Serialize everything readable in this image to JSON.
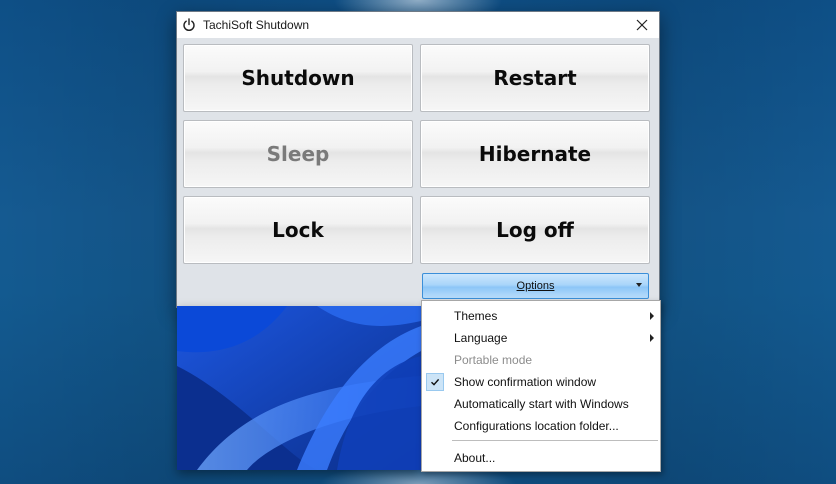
{
  "window": {
    "title": "TachiSoft Shutdown",
    "icon": "power-icon",
    "close_icon": "close-icon"
  },
  "buttons": {
    "shutdown": "Shutdown",
    "restart": "Restart",
    "sleep": "Sleep",
    "hibernate": "Hibernate",
    "lock": "Lock",
    "logoff": "Log off"
  },
  "options": {
    "label": "Options"
  },
  "menu": {
    "themes": "Themes",
    "language": "Language",
    "portable_mode": "Portable mode",
    "show_confirmation": "Show confirmation window",
    "autostart": "Automatically start with Windows",
    "config_folder": "Configurations location folder...",
    "about": "About..."
  },
  "colors": {
    "accent": "#3b8fd9",
    "check_highlight": "#cce4f7",
    "desktop": "#155a91"
  }
}
